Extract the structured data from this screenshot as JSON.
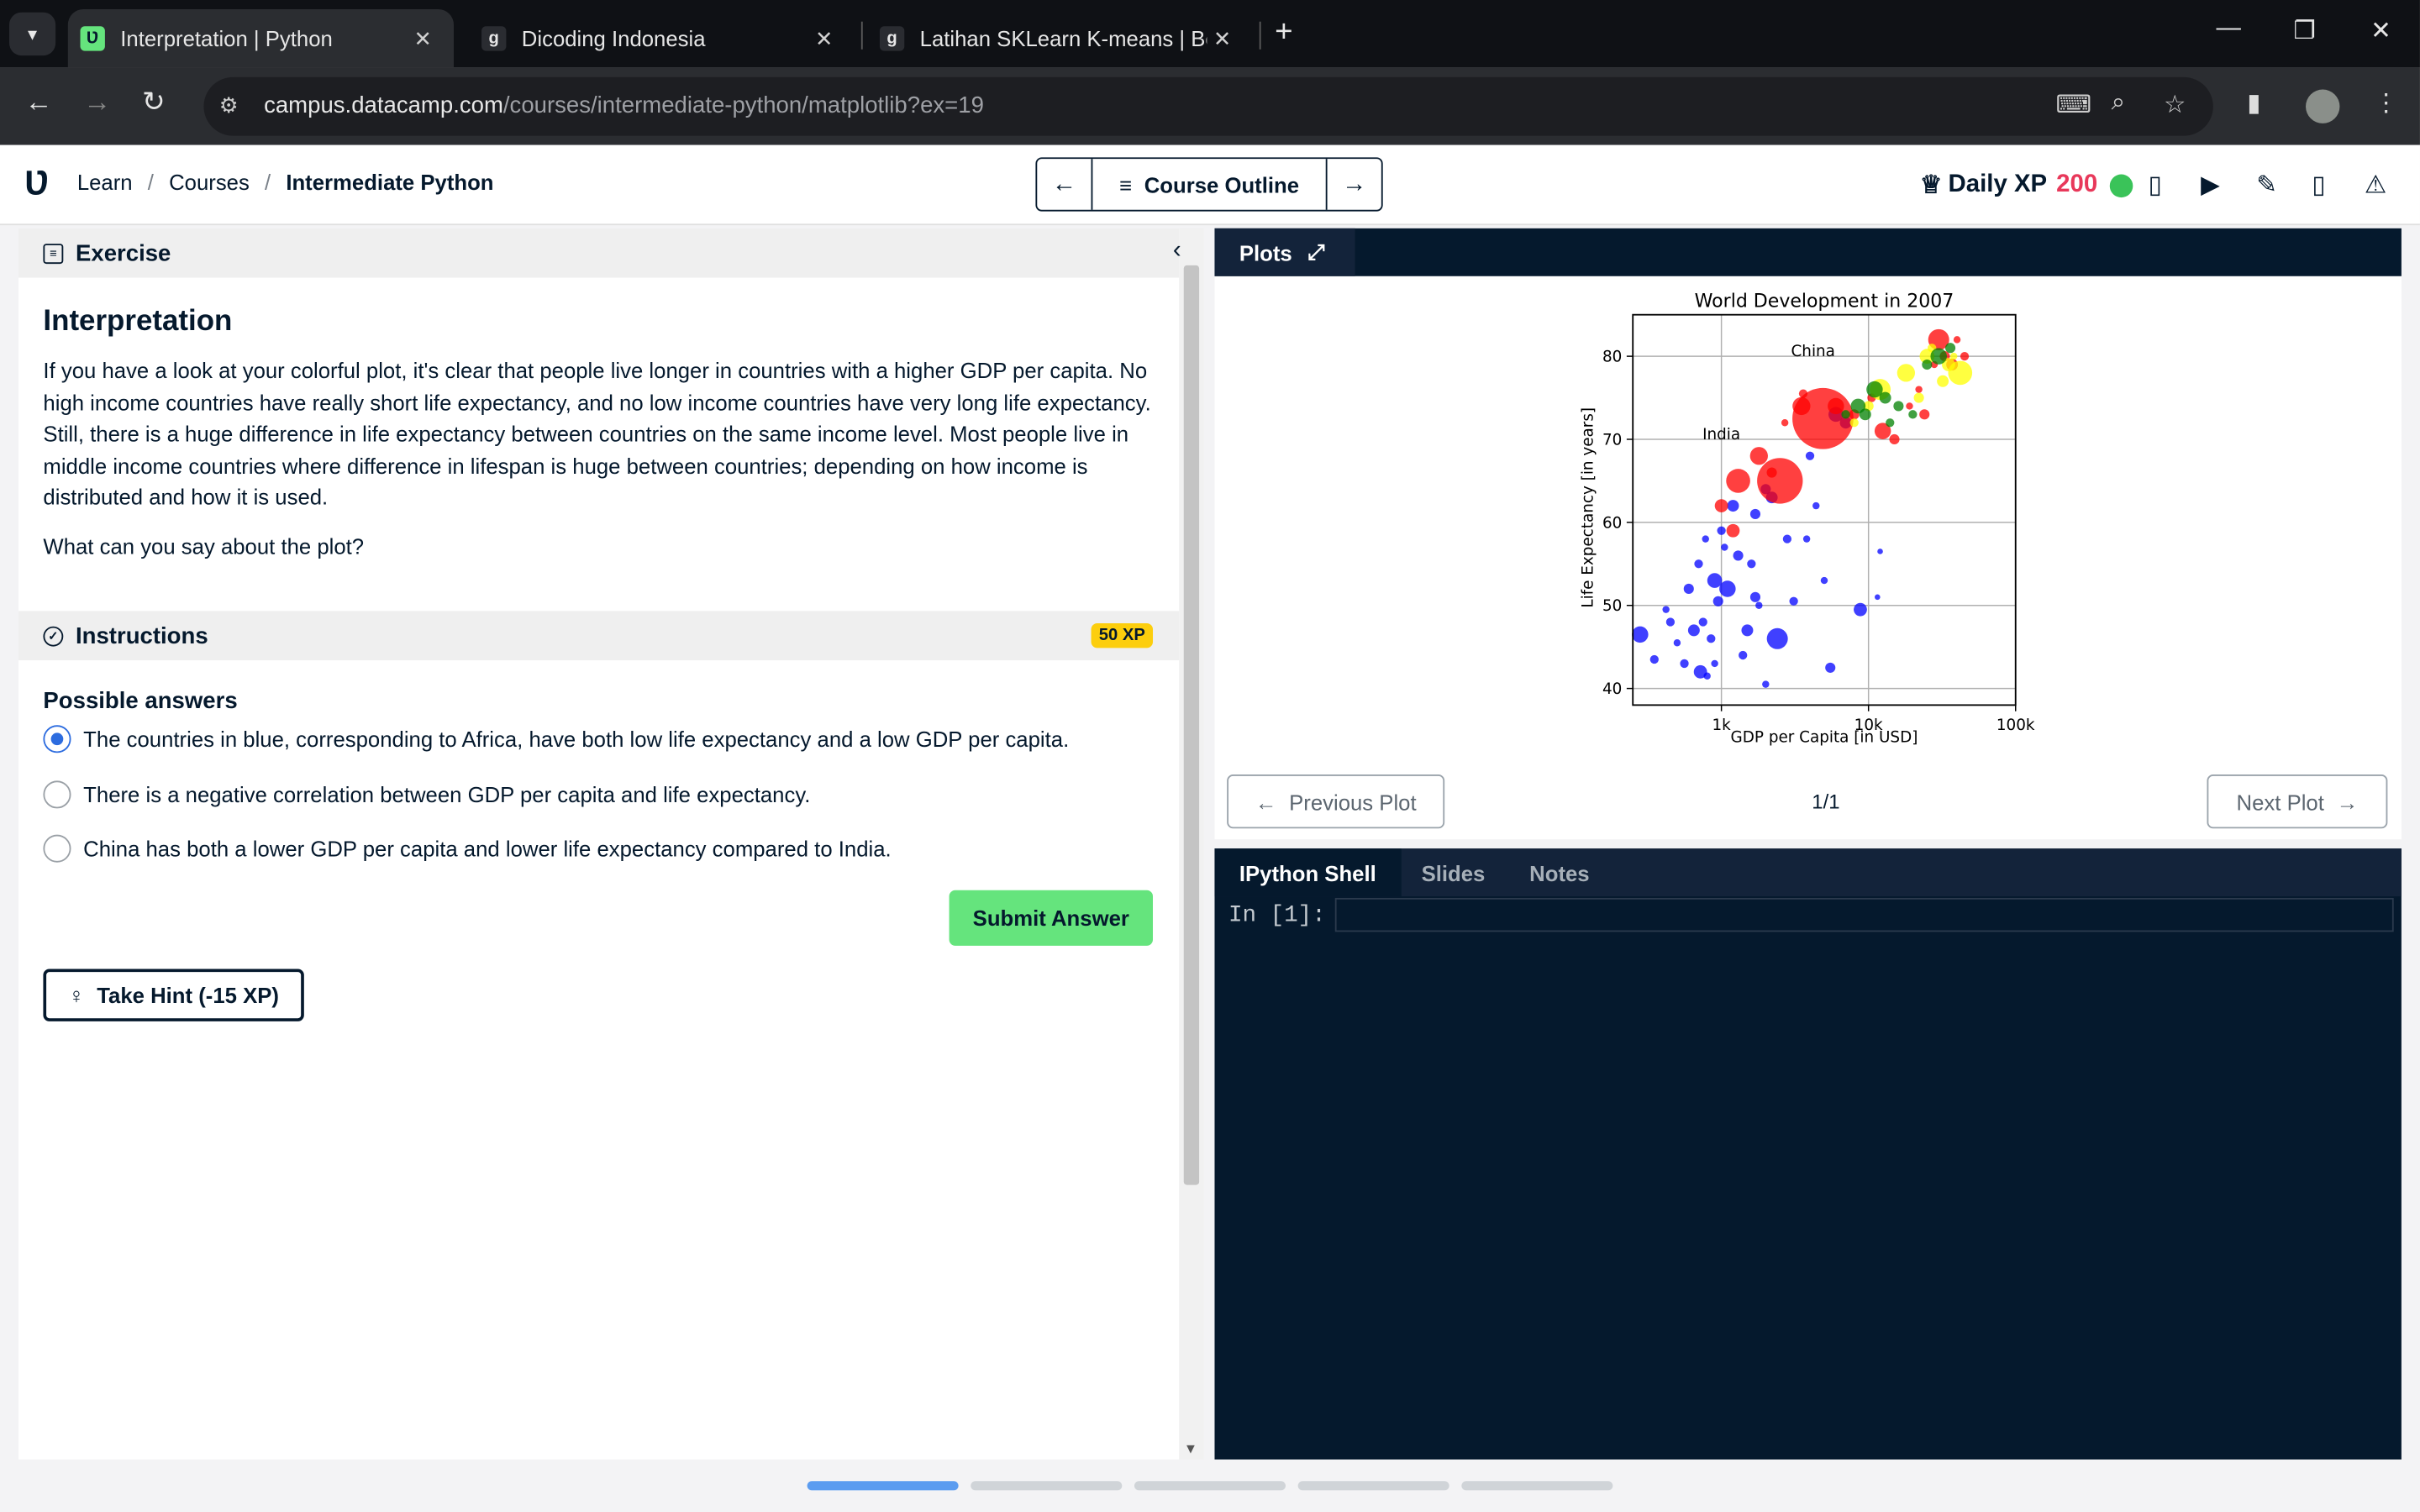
{
  "browser": {
    "tabs": [
      {
        "title": "Interpretation | Python",
        "active": true
      },
      {
        "title": "Dicoding Indonesia",
        "active": false
      },
      {
        "title": "Latihan SKLearn K-means | Bela",
        "active": false
      }
    ],
    "url_host": "campus.datacamp.com",
    "url_path": "/courses/intermediate-python/matplotlib?ex=19"
  },
  "header": {
    "crumbs": [
      "Learn",
      "Courses",
      "Intermediate Python"
    ],
    "course_outline": "Course Outline",
    "daily_xp_label": "Daily XP",
    "daily_xp_value": "200"
  },
  "exercise": {
    "section_label": "Exercise",
    "title": "Interpretation",
    "text": "If you have a look at your colorful plot, it's clear that people live longer in countries with a higher GDP per capita. No high income countries have really short life expectancy, and no low income countries have very long life expectancy. Still, there is a huge difference in life expectancy between countries on the same income level. Most people live in middle income countries where difference in lifespan is huge between countries; depending on how income is distributed and how it is used.",
    "question": "What can you say about the plot?"
  },
  "instructions": {
    "label": "Instructions",
    "xp": "50 XP",
    "possible_answers": "Possible answers",
    "options": [
      "The countries in blue, corresponding to Africa, have both low life expectancy and a low GDP per capita.",
      "There is a negative correlation between GDP per capita and life expectancy.",
      "China has both a lower GDP per capita and lower life expectancy compared to India."
    ],
    "selected_index": 0,
    "submit": "Submit Answer",
    "hint": "Take Hint (-15 XP)"
  },
  "plots": {
    "tab": "Plots",
    "prev": "Previous Plot",
    "next": "Next Plot",
    "count": "1/1"
  },
  "shell": {
    "tabs": [
      "IPython Shell",
      "Slides",
      "Notes"
    ],
    "prompt": "In [1]:"
  },
  "chart_data": {
    "type": "scatter",
    "title": "World Development in 2007",
    "xlabel": "GDP per Capita [in USD]",
    "ylabel": "Life Expectancy [in years]",
    "xscale": "log",
    "xlim": [
      250,
      100000
    ],
    "ylim": [
      38,
      85
    ],
    "xticks": [
      1000,
      10000,
      100000
    ],
    "xticklabels": [
      "1k",
      "10k",
      "100k"
    ],
    "yticks": [
      40,
      50,
      60,
      70,
      80
    ],
    "grid": true,
    "annotations": [
      {
        "text": "India",
        "x": 1000,
        "y": 70
      },
      {
        "text": "China",
        "x": 4200,
        "y": 80
      }
    ],
    "colors": {
      "Africa": "#0000ff",
      "Asia": "#ff0000",
      "Europe": "#ffff00",
      "Americas": "#008000",
      "Oceania": "#000000"
    },
    "series": [
      {
        "color": "#0000ff",
        "points": [
          [
            280,
            46.5,
            9
          ],
          [
            350,
            43.5,
            4
          ],
          [
            420,
            49.5,
            3
          ],
          [
            450,
            48,
            4
          ],
          [
            500,
            45.5,
            3
          ],
          [
            560,
            43,
            4
          ],
          [
            600,
            52,
            5
          ],
          [
            650,
            47,
            6
          ],
          [
            700,
            55,
            4
          ],
          [
            720,
            42,
            7
          ],
          [
            750,
            48,
            4
          ],
          [
            780,
            58,
            3
          ],
          [
            800,
            41.5,
            3
          ],
          [
            850,
            46,
            4
          ],
          [
            900,
            53,
            8
          ],
          [
            950,
            50.5,
            5
          ],
          [
            1000,
            59,
            4
          ],
          [
            1050,
            57,
            3
          ],
          [
            1100,
            52,
            9
          ],
          [
            1200,
            62,
            6
          ],
          [
            1300,
            56,
            5
          ],
          [
            1400,
            44,
            4
          ],
          [
            1500,
            47,
            6
          ],
          [
            1600,
            55,
            4
          ],
          [
            1700,
            61,
            5
          ],
          [
            1800,
            50,
            3
          ],
          [
            2000,
            40.5,
            3
          ],
          [
            2200,
            63,
            6
          ],
          [
            2400,
            46,
            12
          ],
          [
            2800,
            58,
            4
          ],
          [
            3100,
            50.5,
            4
          ],
          [
            3800,
            58,
            3
          ],
          [
            4400,
            62,
            3
          ],
          [
            5000,
            53,
            3
          ],
          [
            5500,
            42.5,
            5
          ],
          [
            8800,
            49.5,
            7
          ],
          [
            11500,
            51,
            2
          ],
          [
            12000,
            56.5,
            2
          ],
          [
            900,
            43,
            3
          ],
          [
            1700,
            51,
            5
          ],
          [
            2000,
            64,
            5
          ],
          [
            6000,
            73,
            8
          ],
          [
            7000,
            72,
            6
          ],
          [
            4000,
            68,
            4
          ]
        ]
      },
      {
        "color": "#ff0000",
        "points": [
          [
            1000,
            62,
            7
          ],
          [
            1300,
            65,
            14
          ],
          [
            2500,
            65,
            28
          ],
          [
            1800,
            68,
            10
          ],
          [
            2700,
            72,
            3
          ],
          [
            4900,
            72.5,
            38
          ],
          [
            3500,
            74,
            10
          ],
          [
            2200,
            66,
            5
          ],
          [
            8000,
            73,
            5
          ],
          [
            10500,
            75,
            4
          ],
          [
            12500,
            71,
            9
          ],
          [
            15000,
            70,
            5
          ],
          [
            19000,
            74,
            3
          ],
          [
            24000,
            73,
            5
          ],
          [
            30000,
            82,
            12
          ],
          [
            33000,
            80,
            5
          ],
          [
            37000,
            79,
            6
          ],
          [
            40000,
            82,
            3
          ],
          [
            45000,
            80,
            4
          ],
          [
            1200,
            59,
            7
          ],
          [
            3600,
            75.5,
            4
          ],
          [
            6000,
            74,
            9
          ],
          [
            28000,
            79,
            3
          ],
          [
            22000,
            76,
            3
          ]
        ]
      },
      {
        "color": "#ffff00",
        "points": [
          [
            12000,
            76,
            12
          ],
          [
            18000,
            78,
            10
          ],
          [
            25000,
            80,
            8
          ],
          [
            35000,
            79,
            7
          ],
          [
            42000,
            78,
            14
          ],
          [
            32000,
            77,
            6
          ],
          [
            22000,
            75,
            5
          ],
          [
            27000,
            81,
            4
          ],
          [
            38000,
            80,
            3
          ],
          [
            8000,
            72,
            4
          ],
          [
            10000,
            74,
            5
          ]
        ]
      },
      {
        "color": "#008000",
        "points": [
          [
            8500,
            74,
            8
          ],
          [
            9500,
            73,
            6
          ],
          [
            14000,
            72,
            4
          ],
          [
            16000,
            74,
            5
          ],
          [
            11000,
            76,
            9
          ],
          [
            13000,
            75,
            6
          ],
          [
            30000,
            80,
            9
          ],
          [
            36000,
            81,
            5
          ],
          [
            7000,
            73,
            4
          ],
          [
            20000,
            73,
            4
          ],
          [
            25000,
            79,
            5
          ]
        ]
      }
    ]
  }
}
